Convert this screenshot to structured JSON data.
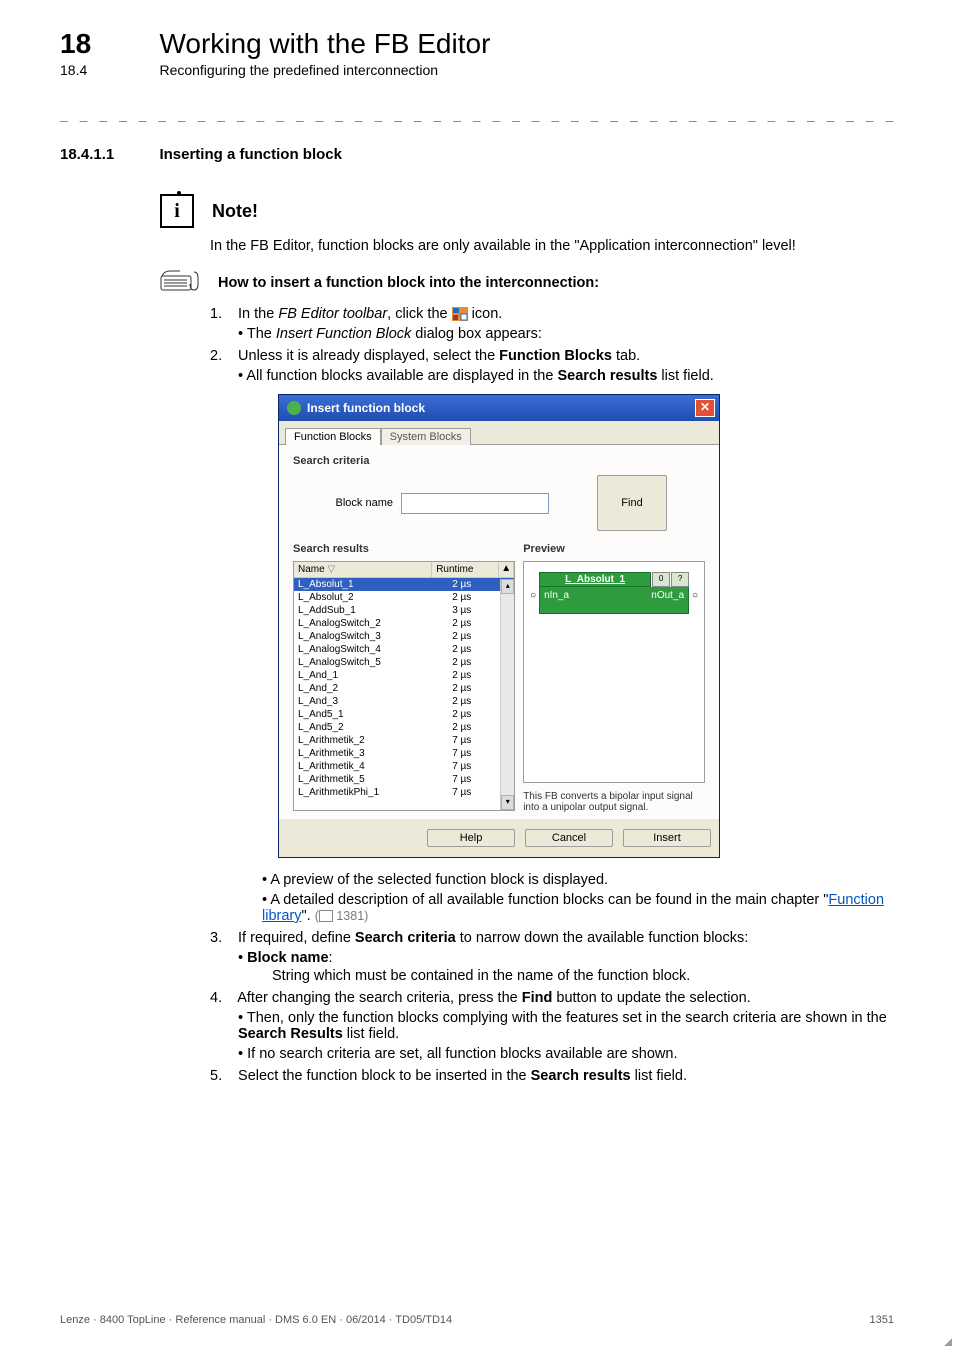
{
  "header": {
    "chapter_num": "18",
    "chapter_title": "Working with the FB Editor",
    "sub_num": "18.4",
    "sub_title": "Reconfiguring the predefined interconnection"
  },
  "section": {
    "num": "18.4.1.1",
    "title": "Inserting a function block"
  },
  "note": {
    "title": "Note!",
    "body": "In the FB Editor, function blocks are only available in the \"Application interconnection\" level!"
  },
  "howto": "How to insert a function block into the interconnection:",
  "steps": {
    "s1": {
      "num": "1.",
      "pre": "In the ",
      "em": "FB Editor toolbar",
      "mid": ", click the ",
      "post": " icon.",
      "sub_pre": "The ",
      "sub_em": "Insert Function Block",
      "sub_post": " dialog box appears:"
    },
    "s2": {
      "num": "2.",
      "pre": "Unless it is already displayed, select the ",
      "b": "Function Blocks",
      "post": " tab.",
      "sub_pre": "All function blocks available are displayed in the ",
      "sub_b": "Search results",
      "sub_post": " list field."
    },
    "after_dialog": {
      "b1": "A preview of the selected function block is displayed.",
      "b2_pre": "A detailed description of all available function blocks can be found in the main chapter \"",
      "b2_link": "Function library",
      "b2_post": "\".",
      "b2_ref": " 1381)"
    },
    "s3": {
      "num": "3.",
      "pre": "If required, define ",
      "b": "Search criteria",
      "post": " to narrow down the available function blocks:",
      "sub_b": "Block name",
      "sub_colon": ":",
      "sub_line": "String which must be contained in the name of the function block."
    },
    "s4": {
      "num": "4.",
      "pre": "After changing the search criteria, press the ",
      "b": "Find",
      "post": " button to update the selection.",
      "sub1_pre": "Then, only the function blocks complying with the features set in the search criteria are shown in the ",
      "sub1_b": "Search Results",
      "sub1_post": " list field.",
      "sub2": "If no search criteria are set, all function blocks available are shown."
    },
    "s5": {
      "num": "5.",
      "pre": "Select the function block to be inserted in the ",
      "b": "Search results",
      "post": " list field."
    }
  },
  "dialog": {
    "title": "Insert function block",
    "tab1": "Function Blocks",
    "tab2": "System Blocks",
    "criteria_title": "Search criteria",
    "block_name_label": "Block name",
    "find": "Find",
    "results_title": "Search results",
    "preview_title": "Preview",
    "col_name": "Name",
    "col_runtime": "Runtime",
    "sort": "▲",
    "rows": [
      {
        "n": "L_Absolut_1",
        "r": "2 µs"
      },
      {
        "n": "L_Absolut_2",
        "r": "2 µs"
      },
      {
        "n": "L_AddSub_1",
        "r": "3 µs"
      },
      {
        "n": "L_AnalogSwitch_2",
        "r": "2 µs"
      },
      {
        "n": "L_AnalogSwitch_3",
        "r": "2 µs"
      },
      {
        "n": "L_AnalogSwitch_4",
        "r": "2 µs"
      },
      {
        "n": "L_AnalogSwitch_5",
        "r": "2 µs"
      },
      {
        "n": "L_And_1",
        "r": "2 µs"
      },
      {
        "n": "L_And_2",
        "r": "2 µs"
      },
      {
        "n": "L_And_3",
        "r": "2 µs"
      },
      {
        "n": "L_And5_1",
        "r": "2 µs"
      },
      {
        "n": "L_And5_2",
        "r": "2 µs"
      },
      {
        "n": "L_Arithmetik_2",
        "r": "7 µs"
      },
      {
        "n": "L_Arithmetik_3",
        "r": "7 µs"
      },
      {
        "n": "L_Arithmetik_4",
        "r": "7 µs"
      },
      {
        "n": "L_Arithmetik_5",
        "r": "7 µs"
      },
      {
        "n": "L_ArithmetikPhi_1",
        "r": "7 µs"
      }
    ],
    "fb": {
      "title": "L_Absolut_1",
      "badge1": "0",
      "badge2": "?",
      "in": "nIn_a",
      "out": "nOut_a"
    },
    "desc": "This FB converts a bipolar input signal into a unipolar output signal.",
    "btn_help": "Help",
    "btn_cancel": "Cancel",
    "btn_insert": "Insert"
  },
  "footer": {
    "left": "Lenze · 8400 TopLine · Reference manual · DMS 6.0 EN · 06/2014 · TD05/TD14",
    "right": "1351"
  }
}
